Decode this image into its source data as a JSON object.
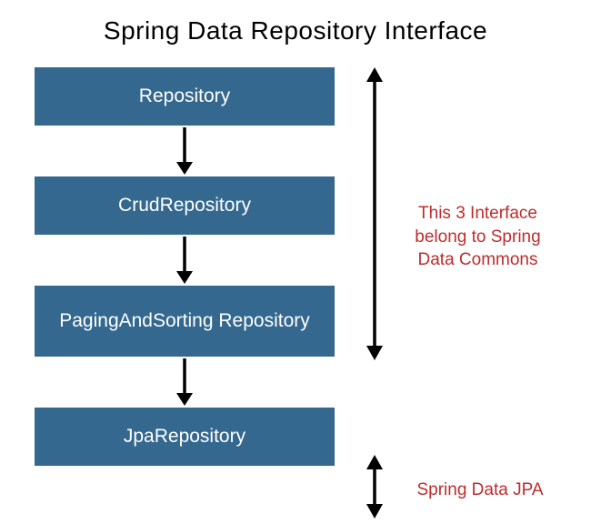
{
  "title": "Spring Data Repository Interface",
  "boxes": {
    "b1": "Repository",
    "b2": "CrudRepository",
    "b3": "PagingAndSorting Repository",
    "b4": "JpaRepository"
  },
  "annotations": {
    "top": "This 3 Interface belong to Spring Data Commons",
    "bottom": "Spring Data JPA"
  },
  "colors": {
    "box_bg": "#34688f",
    "box_text": "#ffffff",
    "annotation_text": "#bf2c2c"
  }
}
